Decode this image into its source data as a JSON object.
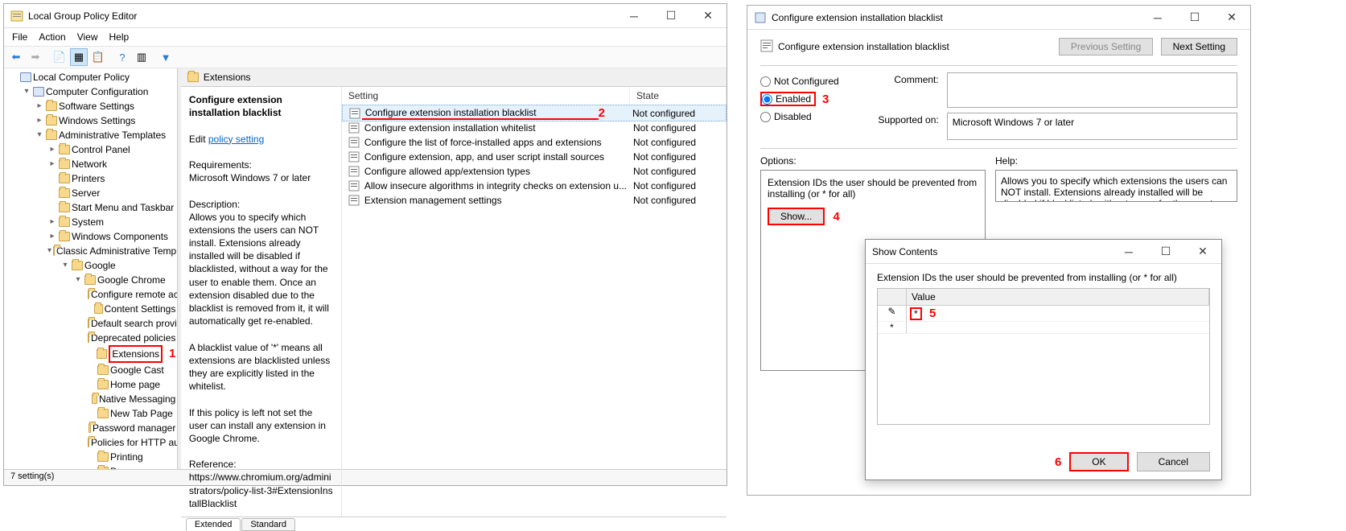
{
  "win1": {
    "title": "Local Group Policy Editor",
    "menu": [
      "File",
      "Action",
      "View",
      "Help"
    ],
    "tree_root": "Local Computer Policy",
    "tree": {
      "computer_config": "Computer Configuration",
      "software_settings": "Software Settings",
      "windows_settings": "Windows Settings",
      "admin_templates": "Administrative Templates",
      "control_panel": "Control Panel",
      "network": "Network",
      "printers": "Printers",
      "server": "Server",
      "start_menu": "Start Menu and Taskbar",
      "system": "System",
      "windows_components": "Windows Components",
      "classic_admin": "Classic Administrative Templates (A",
      "google": "Google",
      "google_chrome": "Google Chrome",
      "config_remote": "Configure remote access",
      "content_settings": "Content Settings",
      "default_search": "Default search provider",
      "deprecated": "Deprecated policies",
      "extensions": "Extensions",
      "google_cast": "Google Cast",
      "home_page": "Home page",
      "native_messaging": "Native Messaging",
      "new_tab": "New Tab Page",
      "password_mgr": "Password manager",
      "http_auth": "Policies for HTTP authe",
      "printing": "Printing",
      "proxy": "Proxy server"
    },
    "path_header": "Extensions",
    "desc": {
      "heading": "Configure extension installation blacklist",
      "edit_prefix": "Edit",
      "edit_link": "policy setting",
      "req_label": "Requirements:",
      "req_value": "Microsoft Windows 7 or later",
      "desc_label": "Description:",
      "desc_body": "Allows you to specify which extensions the users can NOT install. Extensions already installed will be disabled if blacklisted, without a way for the user to enable them. Once an extension disabled due to the blacklist is removed from it, it will automatically get re-enabled.",
      "blacklist_body": "A blacklist value of '*' means all extensions are blacklisted unless they are explicitly listed in the whitelist.",
      "notset_body": "If this policy is left not set the user can install any extension in Google Chrome.",
      "ref_label": "Reference:",
      "ref_value": "https://www.chromium.org/administrators/policy-list-3#ExtensionInstallBlacklist"
    },
    "list_headers": {
      "setting": "Setting",
      "state": "State"
    },
    "settings": [
      {
        "name": "Configure extension installation blacklist",
        "state": "Not configured",
        "sel": true,
        "underline": true
      },
      {
        "name": "Configure extension installation whitelist",
        "state": "Not configured"
      },
      {
        "name": "Configure the list of force-installed apps and extensions",
        "state": "Not configured"
      },
      {
        "name": "Configure extension, app, and user script install sources",
        "state": "Not configured"
      },
      {
        "name": "Configure allowed app/extension types",
        "state": "Not configured"
      },
      {
        "name": "Allow insecure algorithms in integrity checks on extension u...",
        "state": "Not configured"
      },
      {
        "name": "Extension management settings",
        "state": "Not configured"
      }
    ],
    "tabs": {
      "extended": "Extended",
      "standard": "Standard"
    },
    "status": "7 setting(s)"
  },
  "win2": {
    "title": "Configure extension installation blacklist",
    "heading": "Configure extension installation blacklist",
    "prev_btn": "Previous Setting",
    "next_btn": "Next Setting",
    "radio": {
      "not_configured": "Not Configured",
      "enabled": "Enabled",
      "disabled": "Disabled"
    },
    "comment_label": "Comment:",
    "supported_label": "Supported on:",
    "supported_value": "Microsoft Windows 7 or later",
    "options_label": "Options:",
    "help_label": "Help:",
    "opt_text": "Extension IDs the user should be prevented from installing (or * for all)",
    "show_btn": "Show...",
    "help_text": "Allows you to specify which extensions the users can NOT install. Extensions already installed will be disabled if blacklisted, without a way for the user to enable them. Once an extension disabled"
  },
  "dlg": {
    "title": "Show Contents",
    "prompt": "Extension IDs the user should be prevented from installing (or * for all)",
    "col_value": "Value",
    "rows": [
      {
        "marker": "✎",
        "value": "*"
      },
      {
        "marker": "*",
        "value": ""
      }
    ],
    "ok": "OK",
    "cancel": "Cancel"
  },
  "annots": {
    "n1": "1",
    "n2": "2",
    "n3": "3",
    "n4": "4",
    "n5": "5",
    "n6": "6"
  }
}
